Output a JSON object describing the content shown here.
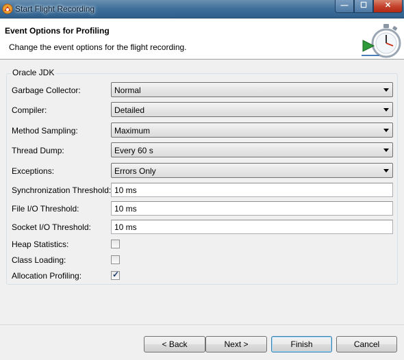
{
  "window": {
    "title": "Start Flight Recording",
    "minimize": "—",
    "maximize": "☐",
    "close": "✕"
  },
  "header": {
    "title": "Event Options for Profiling",
    "description": "Change the event options for the flight recording."
  },
  "group": {
    "title": "Oracle JDK"
  },
  "fields": {
    "garbage_collector": {
      "label": "Garbage Collector:",
      "value": "Normal"
    },
    "compiler": {
      "label": "Compiler:",
      "value": "Detailed"
    },
    "method_sampling": {
      "label": "Method Sampling:",
      "value": "Maximum"
    },
    "thread_dump": {
      "label": "Thread Dump:",
      "value": "Every 60 s"
    },
    "exceptions": {
      "label": "Exceptions:",
      "value": "Errors Only"
    },
    "synchronization_threshold": {
      "label": "Synchronization Threshold:",
      "value": "10 ms"
    },
    "file_io_threshold": {
      "label": "File I/O Threshold:",
      "value": "10 ms"
    },
    "socket_io_threshold": {
      "label": "Socket I/O Threshold:",
      "value": "10 ms"
    },
    "heap_statistics": {
      "label": "Heap Statistics:",
      "checked": false
    },
    "class_loading": {
      "label": "Class Loading:",
      "checked": false
    },
    "allocation_profiling": {
      "label": "Allocation Profiling:",
      "checked": true,
      "mark": "✓"
    }
  },
  "buttons": {
    "back": "< Back",
    "next": "Next >",
    "finish": "Finish",
    "cancel": "Cancel"
  }
}
